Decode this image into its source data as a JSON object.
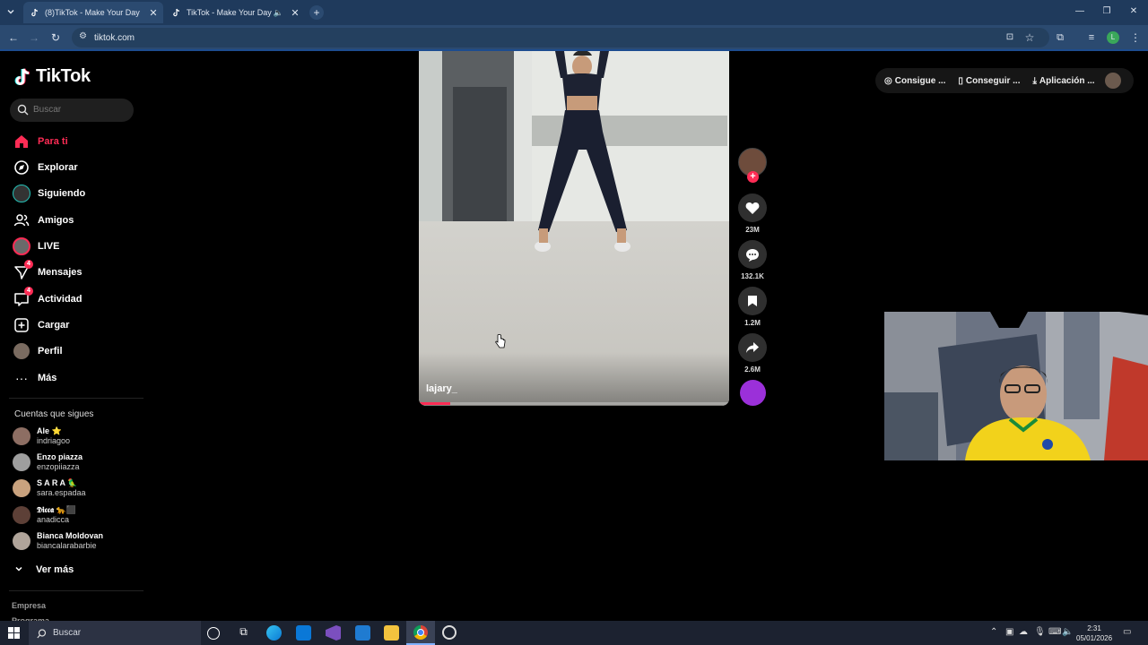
{
  "browser": {
    "tabs": [
      {
        "title": "(8)TikTok - Make Your Day",
        "active": true
      },
      {
        "title": "TikTok - Make Your Day",
        "active": false
      }
    ],
    "url": "tiktok.com"
  },
  "tiktok": {
    "brand": "TikTok",
    "search_placeholder": "Buscar",
    "nav": [
      {
        "label": "Para ti",
        "icon": "home-icon",
        "active": true
      },
      {
        "label": "Explorar",
        "icon": "compass-icon"
      },
      {
        "label": "Siguiendo",
        "icon": "following-avatar-icon"
      },
      {
        "label": "Amigos",
        "icon": "friends-icon"
      },
      {
        "label": "LIVE",
        "icon": "live-icon"
      },
      {
        "label": "Mensajes",
        "icon": "messages-icon",
        "badge": "4"
      },
      {
        "label": "Actividad",
        "icon": "activity-icon",
        "badge": "4"
      },
      {
        "label": "Cargar",
        "icon": "upload-icon"
      },
      {
        "label": "Perfil",
        "icon": "profile-avatar-icon"
      },
      {
        "label": "Más",
        "icon": "more-dots-icon"
      }
    ],
    "following_title": "Cuentas que sigues",
    "following": [
      {
        "name": "Ale ⭐",
        "handle": "indriagoo"
      },
      {
        "name": "Enzo piazza",
        "handle": "enzopiiazza"
      },
      {
        "name": "S A R A 🦜",
        "handle": "sara.espadaa"
      },
      {
        "name": "𝕯𝖎𝖈𝖈𝖆 🐆⬛",
        "handle": "anadicca"
      },
      {
        "name": "Bianca Moldovan",
        "handle": "biancalarabarbie"
      }
    ],
    "see_more": "Ver más",
    "footer": [
      "Empresa",
      "Programa"
    ],
    "topbar": {
      "btn1": "Consigue ...",
      "btn2": "Conseguir ...",
      "btn3": "Aplicación ..."
    },
    "video": {
      "author": "lajary_",
      "progress": 0.1,
      "likes": "23M",
      "comments": "132.1K",
      "saves": "1.2M",
      "shares": "2.6M"
    }
  },
  "taskbar": {
    "search": "Buscar",
    "time": "2:31",
    "date": "05/01/2026"
  },
  "colors": {
    "accent": "#fe2c55",
    "music_disc": "#9b30d9"
  }
}
